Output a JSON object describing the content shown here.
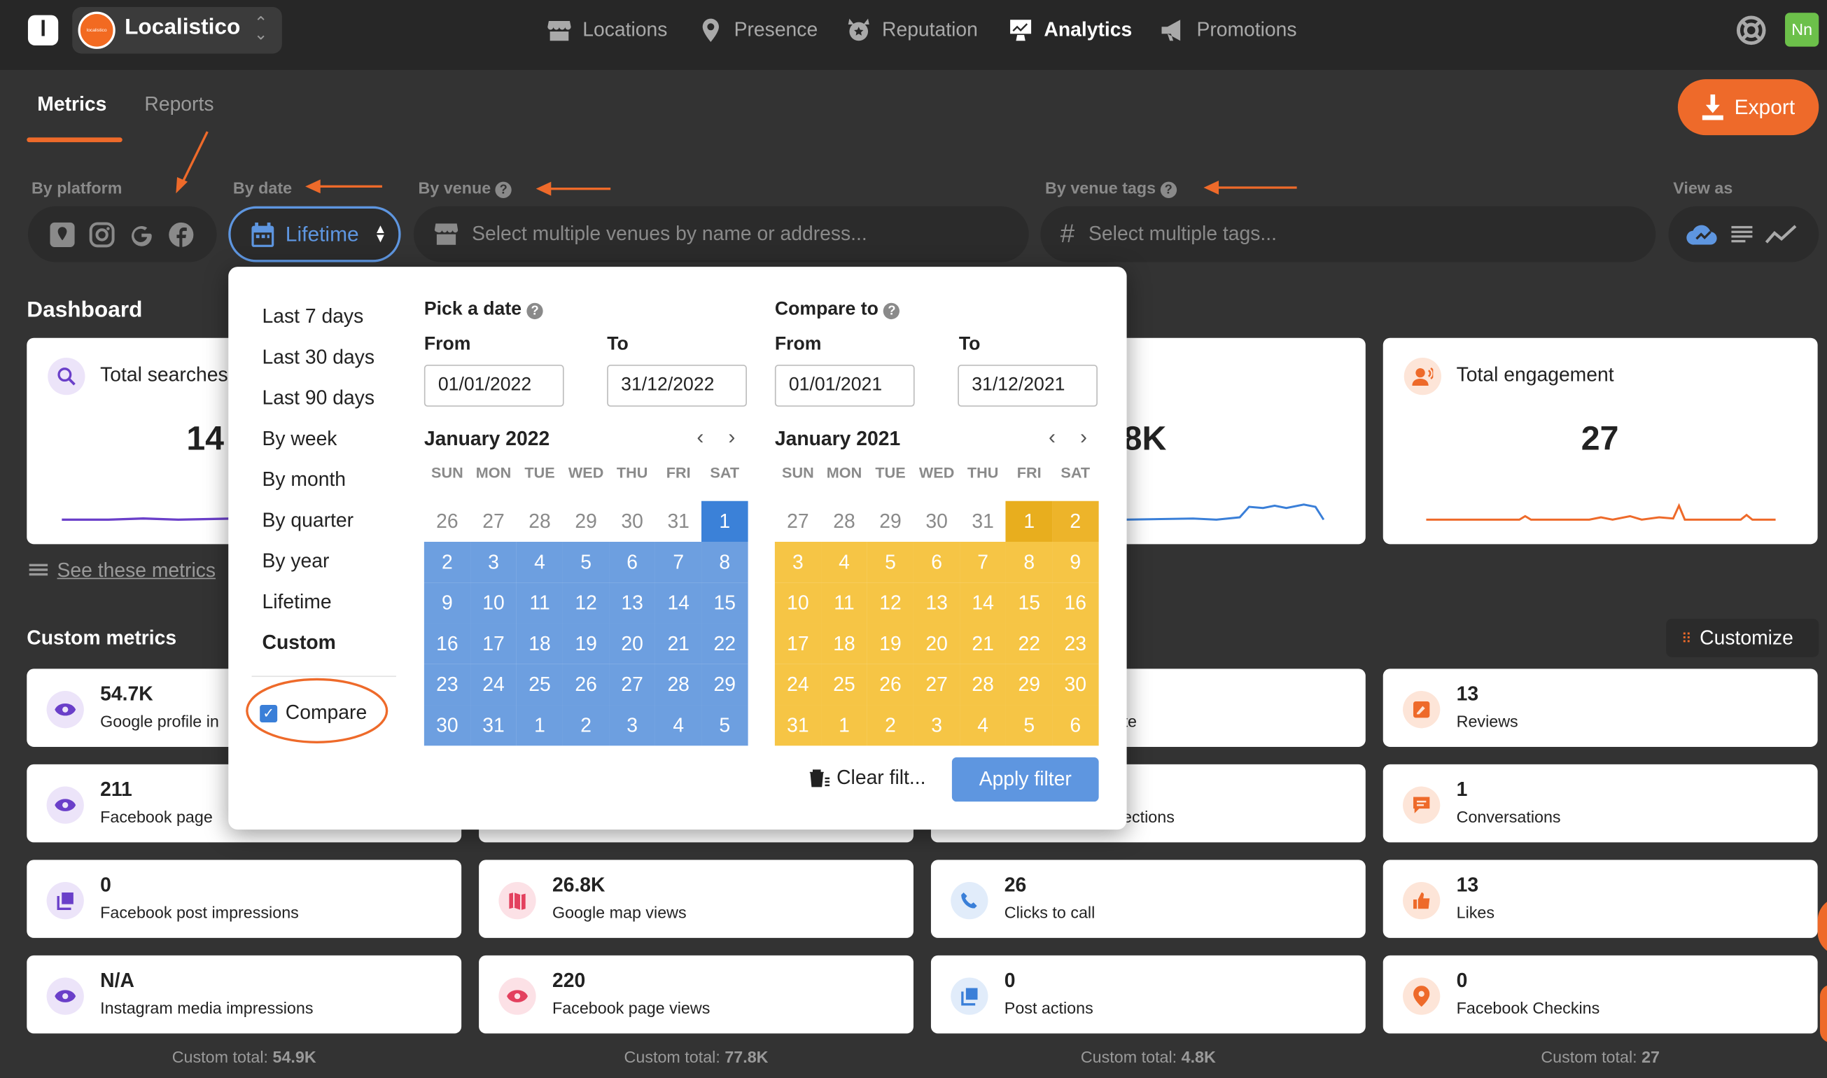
{
  "app": {
    "logo_letter": "l",
    "org_name": "Localistico",
    "org_avatar_text": "localistico",
    "user_initials": "Nn"
  },
  "nav": [
    {
      "label": "Locations",
      "icon": "store-icon"
    },
    {
      "label": "Presence",
      "icon": "presence-pin-icon"
    },
    {
      "label": "Reputation",
      "icon": "reputation-badge-icon"
    },
    {
      "label": "Analytics",
      "icon": "analytics-icon",
      "active": true
    },
    {
      "label": "Promotions",
      "icon": "megaphone-icon"
    }
  ],
  "tabs": {
    "metrics": "Metrics",
    "reports": "Reports"
  },
  "export_label": "Export",
  "filters": {
    "platform_label": "By platform",
    "platforms": [
      "maps-pin-icon",
      "instagram-icon",
      "google-icon",
      "facebook-icon"
    ],
    "date_label": "By date",
    "date_value": "Lifetime",
    "venue_label": "By venue",
    "venue_placeholder": "Select multiple venues by name or address...",
    "tags_label": "By venue tags",
    "tags_placeholder": "Select multiple tags...",
    "viewas_label": "View as",
    "viewas_options": [
      "cloud-icon",
      "list-icon",
      "line-chart-icon"
    ]
  },
  "dashboard": {
    "title": "Dashboard",
    "see_metrics": "See these metrics",
    "cards": [
      {
        "title": "Total searches",
        "value": "14",
        "color": "#6a3fc9"
      },
      {
        "title": "",
        "value": ".8K",
        "color": "#3a7fd8"
      },
      {
        "title": "Total engagement",
        "value": "27",
        "color": "#ee6a2a"
      }
    ]
  },
  "custom": {
    "title": "Custom metrics",
    "customize": "Customize",
    "rows": [
      [
        {
          "value": "54.7K",
          "label": "Google profile in",
          "icon": "eye-icon",
          "color": "#6a3fc9"
        },
        {
          "value": "",
          "label": "te",
          "icon": "",
          "color": ""
        },
        {
          "value": "13",
          "label": "Reviews",
          "icon": "review-icon",
          "color": "#ee6a2a"
        }
      ],
      [
        {
          "value": "211",
          "label": "Facebook page",
          "icon": "eye-icon",
          "color": "#6a3fc9"
        },
        {
          "value": "",
          "label": "rections",
          "icon": "",
          "color": ""
        },
        {
          "value": "1",
          "label": "Conversations",
          "icon": "chat-icon",
          "color": "#ee6a2a"
        }
      ],
      [
        {
          "value": "0",
          "label": "Facebook post impressions",
          "icon": "posts-icon",
          "color": "#6a3fc9"
        },
        {
          "value": "26.8K",
          "label": "Google map views",
          "icon": "map-icon",
          "color": "#e3405e"
        },
        {
          "value": "26",
          "label": "Clicks to call",
          "icon": "phone-icon",
          "color": "#3a7fd8"
        },
        {
          "value": "13",
          "label": "Likes",
          "icon": "thumbs-up-icon",
          "color": "#ee6a2a"
        }
      ],
      [
        {
          "value": "N/A",
          "label": "Instagram media impressions",
          "icon": "eye-icon",
          "color": "#6a3fc9"
        },
        {
          "value": "220",
          "label": "Facebook page views",
          "icon": "eye-icon",
          "color": "#e3405e"
        },
        {
          "value": "0",
          "label": "Post actions",
          "icon": "posts-icon",
          "color": "#3a7fd8"
        },
        {
          "value": "0",
          "label": "Facebook Checkins",
          "icon": "pin-icon",
          "color": "#ee6a2a"
        }
      ]
    ],
    "totals": [
      "Custom total: ",
      "54.9K",
      "Custom total: ",
      "77.8K",
      "Custom total: ",
      "4.8K",
      "Custom total: ",
      "27"
    ]
  },
  "datepicker": {
    "presets": [
      "Last 7 days",
      "Last 30 days",
      "Last 90 days",
      "By week",
      "By month",
      "By quarter",
      "By year",
      "Lifetime",
      "Custom"
    ],
    "compare_label": "Compare",
    "compare_checked": true,
    "pick_title": "Pick a date",
    "compare_title": "Compare to",
    "from_label": "From",
    "to_label": "To",
    "pick_from": "01/01/2022",
    "pick_to": "31/12/2022",
    "cmp_from": "01/01/2021",
    "cmp_to": "31/12/2021",
    "weekdays": [
      "SUN",
      "MON",
      "TUE",
      "WED",
      "THU",
      "FRI",
      "SAT"
    ],
    "cal1": {
      "title": "January 2022",
      "days": [
        "26",
        "27",
        "28",
        "29",
        "30",
        "31",
        "1",
        "2",
        "3",
        "4",
        "5",
        "6",
        "7",
        "8",
        "9",
        "10",
        "11",
        "12",
        "13",
        "14",
        "15",
        "16",
        "17",
        "18",
        "19",
        "20",
        "21",
        "22",
        "23",
        "24",
        "25",
        "26",
        "27",
        "28",
        "29",
        "30",
        "31",
        "1",
        "2",
        "3",
        "4",
        "5"
      ]
    },
    "cal2": {
      "title": "January 2021",
      "days": [
        "27",
        "28",
        "29",
        "30",
        "31",
        "1",
        "2",
        "3",
        "4",
        "5",
        "6",
        "7",
        "8",
        "9",
        "10",
        "11",
        "12",
        "13",
        "14",
        "15",
        "16",
        "17",
        "18",
        "19",
        "20",
        "21",
        "22",
        "23",
        "24",
        "25",
        "26",
        "27",
        "28",
        "29",
        "30",
        "31",
        "1",
        "2",
        "3",
        "4",
        "5",
        "6"
      ]
    },
    "clear_label": "Clear filt...",
    "apply_label": "Apply filter"
  }
}
